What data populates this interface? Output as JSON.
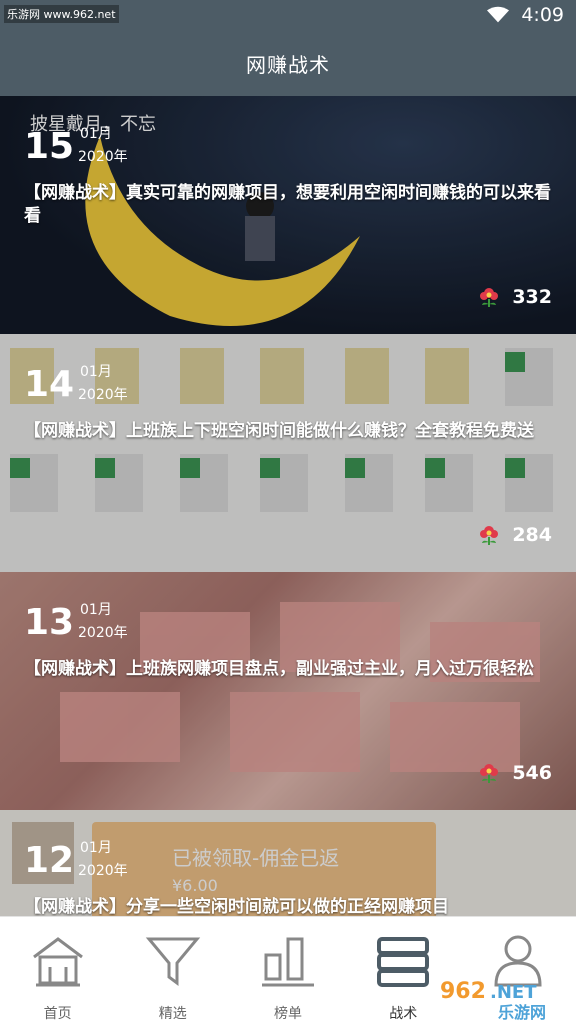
{
  "status_bar": {
    "watermark": "乐游网 www.962.net",
    "time": "4:09"
  },
  "header": {
    "title": "网赚战术"
  },
  "feed": [
    {
      "day": "15",
      "month": "01月",
      "year": "2020年",
      "title": "【网赚战术】真实可靠的网赚项目，想要利用空闲时间赚钱的可以来看看",
      "likes": "332",
      "image_text": "披星戴月，不忘"
    },
    {
      "day": "14",
      "month": "01月",
      "year": "2020年",
      "title": "【网赚战术】上班族上下班空闲时间能做什么赚钱？全套教程免费送",
      "likes": "284",
      "image_text": ""
    },
    {
      "day": "13",
      "month": "01月",
      "year": "2020年",
      "title": "【网赚战术】上班族网赚项目盘点，副业强过主业，月入过万很轻松",
      "likes": "546",
      "image_text": ""
    },
    {
      "day": "12",
      "month": "01月",
      "year": "2020年",
      "title": "【网赚战术】分享一些空闲时间就可以做的正经网赚项目",
      "likes": "",
      "image_text": "已被领取-佣金已返",
      "image_subtext": "¥6.00"
    }
  ],
  "tabs": [
    {
      "label": "首页",
      "icon": "home-icon"
    },
    {
      "label": "精选",
      "icon": "filter-icon"
    },
    {
      "label": "榜单",
      "icon": "chart-icon"
    },
    {
      "label": "战术",
      "icon": "book-icon"
    },
    {
      "label": "",
      "icon": "user-icon"
    }
  ],
  "watermark_bottom": "962.NET 乐游网",
  "colors": {
    "header": "#4d5c66",
    "like_flower": "#e03a4a"
  }
}
